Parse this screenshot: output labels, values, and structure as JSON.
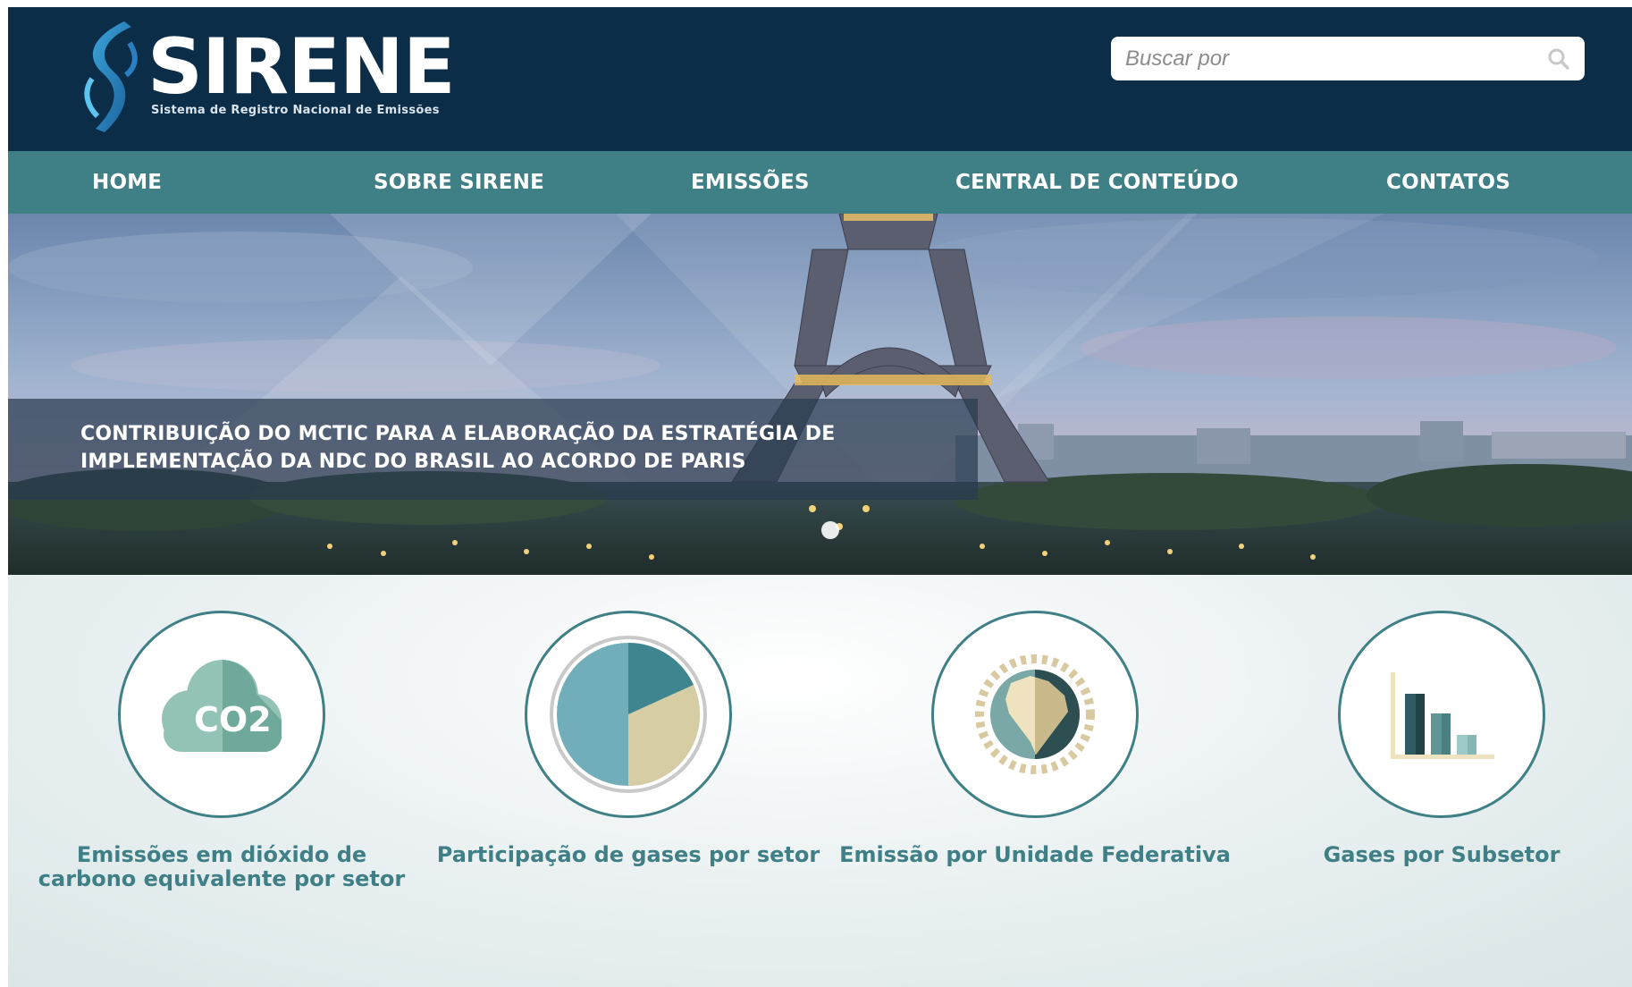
{
  "brand": {
    "title": "SIRENE",
    "subtitle": "Sistema de Registro Nacional de Emissões"
  },
  "search": {
    "placeholder": "Buscar por",
    "value": ""
  },
  "nav": {
    "items": [
      {
        "label": "HOME"
      },
      {
        "label": "SOBRE SIRENE"
      },
      {
        "label": "EMISSÕES"
      },
      {
        "label": "CENTRAL DE CONTEÚDO"
      },
      {
        "label": "CONTATOS"
      }
    ]
  },
  "hero": {
    "caption": "CONTRIBUIÇÃO DO MCTIC PARA A ELABORAÇÃO DA ESTRATÉGIA DE IMPLEMENTAÇÃO DA NDC DO BRASIL AO ACORDO DE PARIS",
    "icon": "eiffel-tower-photo"
  },
  "features": [
    {
      "label": "Emissões em dióxido de carbono equivalente por setor",
      "icon": "co2-cloud-icon",
      "icon_text": "CO2"
    },
    {
      "label": "Participação de gases por setor",
      "icon": "pie-chart-icon"
    },
    {
      "label": "Emissão por Unidade Federativa",
      "icon": "brazil-map-icon"
    },
    {
      "label": "Gases por Subsetor",
      "icon": "bar-chart-icon"
    }
  ],
  "colors": {
    "header_bg": "#0c2d48",
    "nav_bg": "#3f7f86",
    "accent": "#3f7f86",
    "search_bg": "#ffffff"
  }
}
